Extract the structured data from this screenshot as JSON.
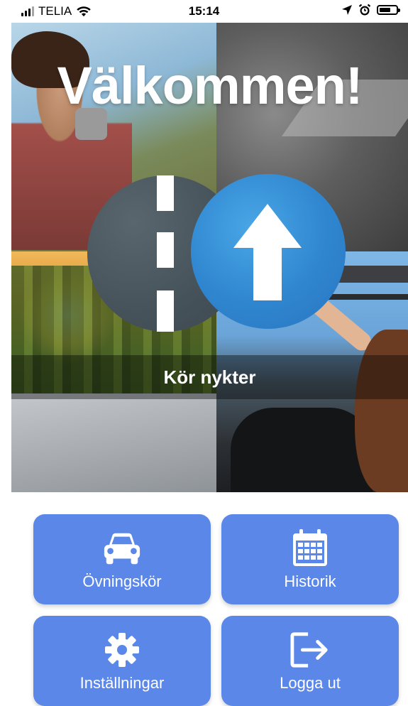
{
  "status_bar": {
    "carrier": "TELIA",
    "time": "15:14",
    "battery_level": 0.7
  },
  "hero": {
    "title": "Välkommen!",
    "tagline": "Kör nykter"
  },
  "menu": [
    {
      "label": "Övningskör",
      "icon": "car-icon"
    },
    {
      "label": "Historik",
      "icon": "calendar-icon"
    },
    {
      "label": "Inställningar",
      "icon": "gear-icon"
    },
    {
      "label": "Logga ut",
      "icon": "logout-icon"
    }
  ],
  "colors": {
    "button": "#5b87e9",
    "logo_blue": "#2f86cf",
    "logo_gray": "#46525a"
  }
}
